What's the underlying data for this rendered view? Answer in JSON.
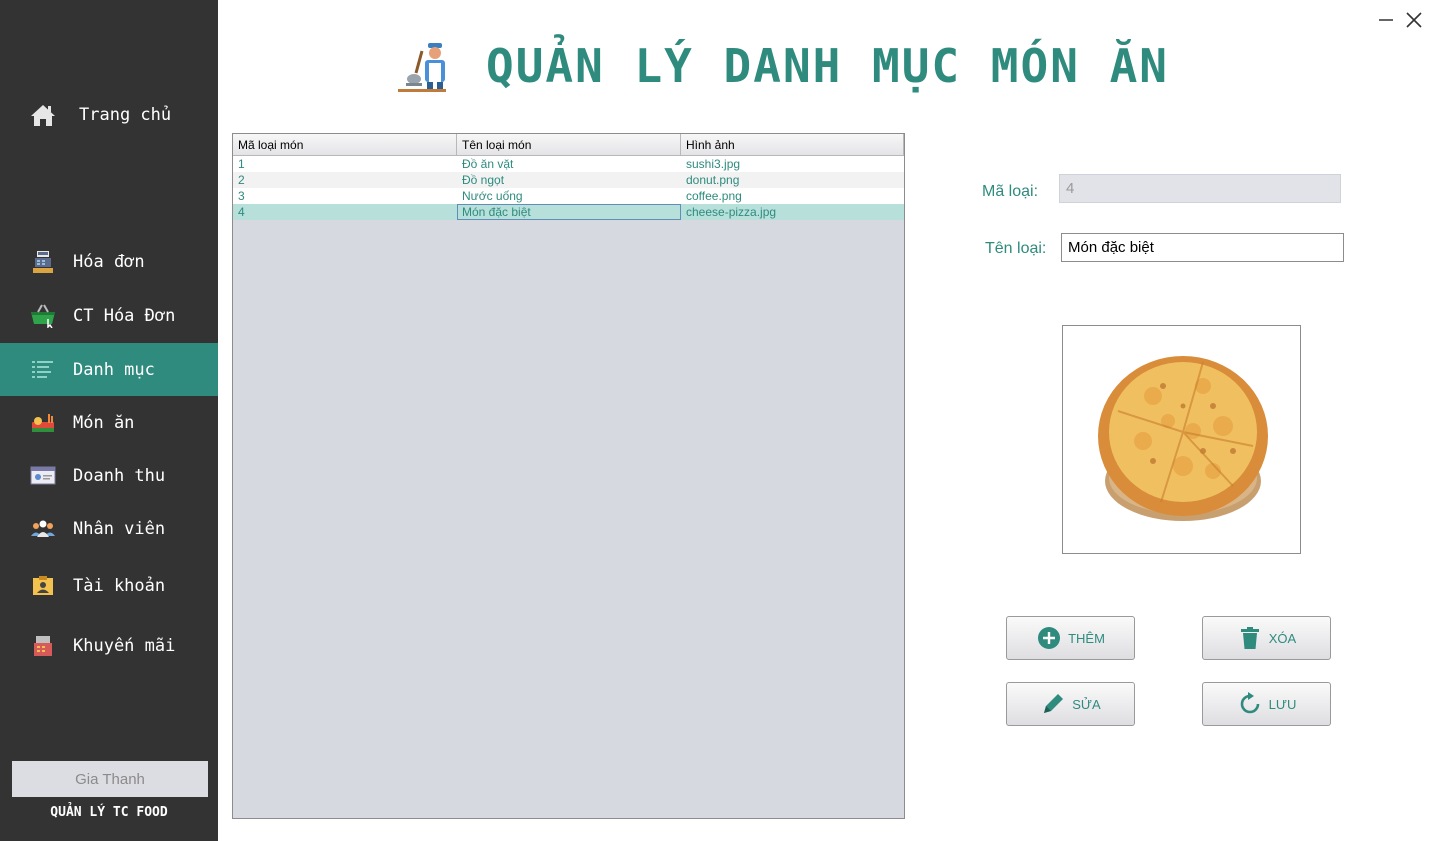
{
  "window": {
    "minimize_icon": "minimize-icon",
    "close_icon": "close-icon"
  },
  "sidebar": {
    "home": {
      "label": "Trang chủ",
      "icon": "home-icon"
    },
    "items": [
      {
        "label": "Hóa đơn",
        "icon": "cash-register-icon",
        "active": false
      },
      {
        "label": "CT Hóa Đơn",
        "icon": "basket-icon",
        "active": false
      },
      {
        "label": "Danh mục",
        "icon": "list-icon",
        "active": true
      },
      {
        "label": "Món ăn",
        "icon": "food-icon",
        "active": false
      },
      {
        "label": "Doanh thu",
        "icon": "revenue-board-icon",
        "active": false
      },
      {
        "label": "Nhân viên",
        "icon": "staff-icon",
        "active": false
      },
      {
        "label": "Tài khoản",
        "icon": "account-card-icon",
        "active": false
      },
      {
        "label": "Khuyến mãi",
        "icon": "promotion-icon",
        "active": false
      }
    ],
    "user_name": "Gia Thanh",
    "app_name": "QUẢN LÝ TC FOOD"
  },
  "header": {
    "title": "QUẢN LÝ DANH MỤC MÓN ĂN",
    "icon": "chef-icon"
  },
  "table": {
    "columns": [
      "Mã loại món",
      "Tên loại món",
      "Hình ảnh"
    ],
    "rows": [
      [
        "1",
        "Đồ ăn vặt",
        "sushi3.jpg"
      ],
      [
        "2",
        "Đồ ngọt",
        "donut.png"
      ],
      [
        "3",
        "Nước uống",
        "coffee.png"
      ],
      [
        "4",
        "Món đặc biệt",
        "cheese-pizza.jpg"
      ]
    ],
    "selected_row": 3
  },
  "form": {
    "ma_loai_label": "Mã loại:",
    "ma_loai_value": "4",
    "ten_loai_label": "Tên loại:",
    "ten_loai_value": "Món đặc biệt",
    "image_alt": "pizza-image"
  },
  "buttons": {
    "them": {
      "label": "THÊM",
      "icon": "add-circle-icon"
    },
    "xoa": {
      "label": "XÓA",
      "icon": "trash-icon"
    },
    "sua": {
      "label": "SỬA",
      "icon": "pencil-icon"
    },
    "luu": {
      "label": "LƯU",
      "icon": "refresh-icon"
    }
  },
  "colors": {
    "accent": "#2e8b7e",
    "sidebar_bg": "#333333",
    "table_bg": "#d6d9e0",
    "selected_row": "#b8e0db"
  }
}
